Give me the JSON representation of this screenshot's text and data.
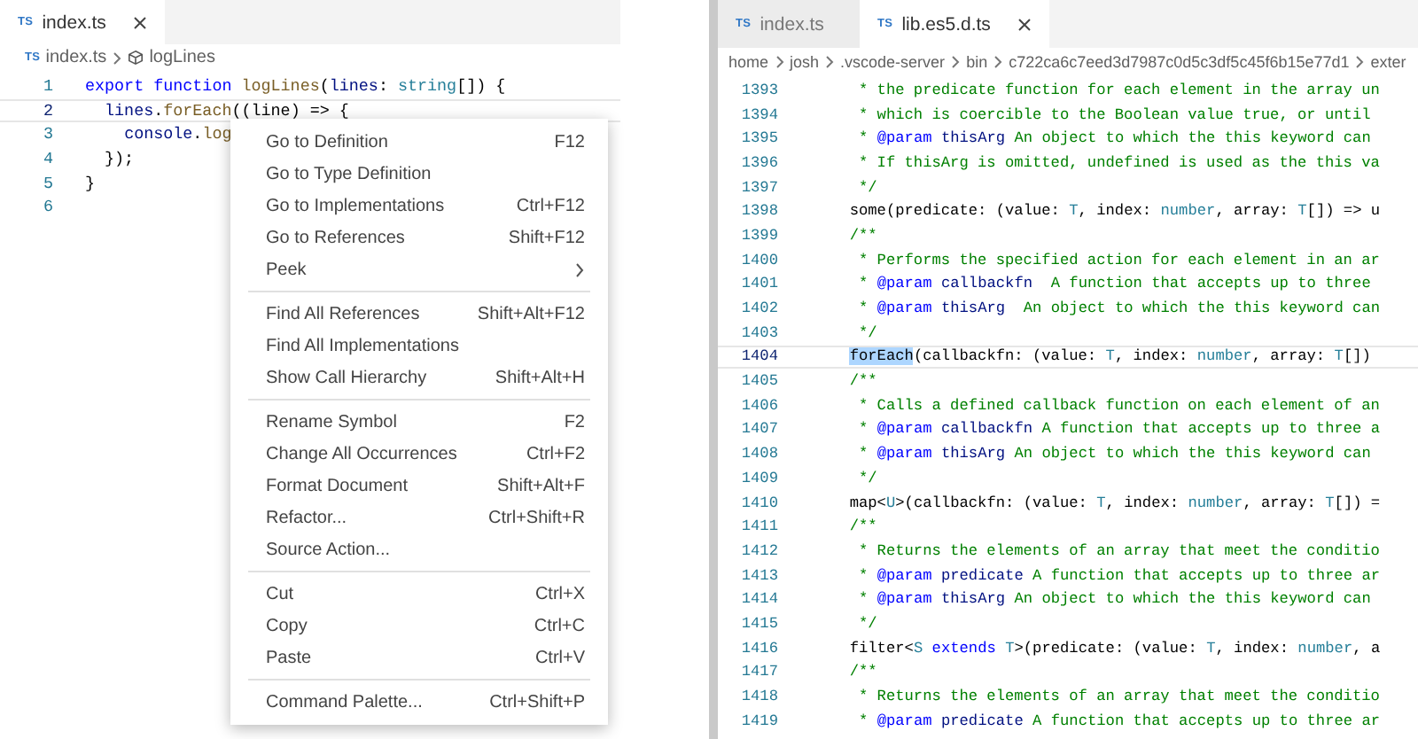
{
  "left_editor": {
    "tabs": [
      {
        "icon": "TS",
        "label": "index.ts",
        "selected": true
      }
    ],
    "breadcrumb": [
      {
        "kind": "file",
        "icon": "TS",
        "label": "index.ts"
      },
      {
        "kind": "symbol",
        "label": "logLines"
      }
    ],
    "lines": [
      {
        "number": "1",
        "current": false,
        "tokens": [
          {
            "kind": "kw",
            "t": "export"
          },
          {
            "kind": "kw",
            "t": " function"
          },
          {
            "kind": "fn",
            "t": " logLines"
          },
          {
            "kind": "plain",
            "t": "("
          },
          {
            "kind": "param",
            "t": "lines"
          },
          {
            "kind": "plain",
            "t": ":"
          },
          {
            "kind": "type",
            "t": " string"
          },
          {
            "kind": "plain",
            "t": "[]) {"
          }
        ]
      },
      {
        "number": "2",
        "current": true,
        "tokens": [
          {
            "kind": "param",
            "t": "  lines"
          },
          {
            "kind": "plain",
            "t": "."
          },
          {
            "kind": "fn",
            "t": "forEach"
          },
          {
            "kind": "plain",
            "t": "((line) => {"
          }
        ]
      },
      {
        "number": "3",
        "current": false,
        "tokens": [
          {
            "kind": "param",
            "t": "    console"
          },
          {
            "kind": "plain",
            "t": "."
          },
          {
            "kind": "fn",
            "t": "log"
          }
        ]
      },
      {
        "number": "4",
        "current": false,
        "tokens": [
          {
            "kind": "plain",
            "t": "  });"
          }
        ]
      },
      {
        "number": "5",
        "current": false,
        "tokens": [
          {
            "kind": "plain",
            "t": "}"
          }
        ]
      },
      {
        "number": "6",
        "current": false
      }
    ]
  },
  "context_menu": {
    "groups": [
      [
        {
          "label": "Go to Definition",
          "shortcut": "F12"
        },
        {
          "label": "Go to Type Definition"
        },
        {
          "label": "Go to Implementations",
          "shortcut": "Ctrl+F12"
        },
        {
          "label": "Go to References",
          "shortcut": "Shift+F12"
        },
        {
          "label": "Peek",
          "submenu": true
        }
      ],
      [
        {
          "label": "Find All References",
          "shortcut": "Shift+Alt+F12"
        },
        {
          "label": "Find All Implementations"
        },
        {
          "label": "Show Call Hierarchy",
          "shortcut": "Shift+Alt+H"
        }
      ],
      [
        {
          "label": "Rename Symbol",
          "shortcut": "F2"
        },
        {
          "label": "Change All Occurrences",
          "shortcut": "Ctrl+F2"
        },
        {
          "label": "Format Document",
          "shortcut": "Shift+Alt+F"
        },
        {
          "label": "Refactor...",
          "shortcut": "Ctrl+Shift+R"
        },
        {
          "label": "Source Action..."
        }
      ],
      [
        {
          "label": "Cut",
          "shortcut": "Ctrl+X"
        },
        {
          "label": "Copy",
          "shortcut": "Ctrl+C"
        },
        {
          "label": "Paste",
          "shortcut": "Ctrl+V"
        }
      ],
      [
        {
          "label": "Command Palette...",
          "shortcut": "Ctrl+Shift+P"
        }
      ]
    ]
  },
  "right_editor": {
    "tabs": [
      {
        "icon": "TS",
        "label": "index.ts",
        "selected": false
      },
      {
        "icon": "TS",
        "label": "lib.es5.d.ts",
        "selected": true
      }
    ],
    "breadcrumb": [
      {
        "label": "home"
      },
      {
        "label": "josh"
      },
      {
        "label": ".vscode-server"
      },
      {
        "label": "bin"
      },
      {
        "label": "c722ca6c7eed3d7987c0d5c3df5c45f6b15e77d1"
      },
      {
        "label": "exter"
      }
    ],
    "lines": [
      {
        "number": "1393",
        "current": false,
        "tokens": [
          {
            "kind": "comment",
            "t": "   * the predicate function for each element in the array un"
          }
        ]
      },
      {
        "number": "1394",
        "current": false,
        "tokens": [
          {
            "kind": "comment",
            "t": "   * which is coercible to the Boolean value true, or until"
          }
        ]
      },
      {
        "number": "1395",
        "current": false,
        "tokens": [
          {
            "kind": "comment",
            "t": "   *"
          },
          {
            "kind": "tag",
            "t": " @param"
          },
          {
            "kind": "param",
            "t": " thisArg"
          },
          {
            "kind": "comment",
            "t": " An object to which the this keyword can"
          }
        ]
      },
      {
        "number": "1396",
        "current": false,
        "tokens": [
          {
            "kind": "comment",
            "t": "   * If thisArg is omitted, undefined is used as the this va"
          }
        ]
      },
      {
        "number": "1397",
        "current": false,
        "tokens": [
          {
            "kind": "comment",
            "t": "   */"
          }
        ]
      },
      {
        "number": "1398",
        "current": false,
        "tokens": [
          {
            "kind": "plain",
            "t": "  some(predicate: (value:"
          },
          {
            "kind": "type",
            "t": " T"
          },
          {
            "kind": "plain",
            "t": ", index:"
          },
          {
            "kind": "type",
            "t": " number"
          },
          {
            "kind": "plain",
            "t": ", array:"
          },
          {
            "kind": "type",
            "t": " T"
          },
          {
            "kind": "plain",
            "t": "[]) => u"
          }
        ]
      },
      {
        "number": "1399",
        "current": false,
        "tokens": [
          {
            "kind": "comment",
            "t": "  /**"
          }
        ]
      },
      {
        "number": "1400",
        "current": false,
        "tokens": [
          {
            "kind": "comment",
            "t": "   * Performs the specified action for each element in an ar"
          }
        ]
      },
      {
        "number": "1401",
        "current": false,
        "tokens": [
          {
            "kind": "comment",
            "t": "   *"
          },
          {
            "kind": "tag",
            "t": " @param"
          },
          {
            "kind": "param",
            "t": " callbackfn"
          },
          {
            "kind": "comment",
            "t": "  A function that accepts up to three"
          }
        ]
      },
      {
        "number": "1402",
        "current": false,
        "tokens": [
          {
            "kind": "comment",
            "t": "   *"
          },
          {
            "kind": "tag",
            "t": " @param"
          },
          {
            "kind": "param",
            "t": " thisArg"
          },
          {
            "kind": "comment",
            "t": "  An object to which the this keyword can"
          }
        ]
      },
      {
        "number": "1403",
        "current": false,
        "tokens": [
          {
            "kind": "comment",
            "t": "   */"
          }
        ]
      },
      {
        "number": "1404",
        "current": true,
        "tokens": [
          {
            "kind": "match",
            "t": "  forEach"
          },
          {
            "kind": "plain",
            "t": "(callbackfn: (value:"
          },
          {
            "kind": "type",
            "t": " T"
          },
          {
            "kind": "plain",
            "t": ", index:"
          },
          {
            "kind": "type",
            "t": " number"
          },
          {
            "kind": "plain",
            "t": ", array:"
          },
          {
            "kind": "type",
            "t": " T"
          },
          {
            "kind": "plain",
            "t": "[])"
          }
        ]
      },
      {
        "number": "1405",
        "current": false,
        "tokens": [
          {
            "kind": "comment",
            "t": "  /**"
          }
        ]
      },
      {
        "number": "1406",
        "current": false,
        "tokens": [
          {
            "kind": "comment",
            "t": "   * Calls a defined callback function on each element of an"
          }
        ]
      },
      {
        "number": "1407",
        "current": false,
        "tokens": [
          {
            "kind": "comment",
            "t": "   *"
          },
          {
            "kind": "tag",
            "t": " @param"
          },
          {
            "kind": "param",
            "t": " callbackfn"
          },
          {
            "kind": "comment",
            "t": " A function that accepts up to three a"
          }
        ]
      },
      {
        "number": "1408",
        "current": false,
        "tokens": [
          {
            "kind": "comment",
            "t": "   *"
          },
          {
            "kind": "tag",
            "t": " @param"
          },
          {
            "kind": "param",
            "t": " thisArg"
          },
          {
            "kind": "comment",
            "t": " An object to which the this keyword can"
          }
        ]
      },
      {
        "number": "1409",
        "current": false,
        "tokens": [
          {
            "kind": "comment",
            "t": "   */"
          }
        ]
      },
      {
        "number": "1410",
        "current": false,
        "tokens": [
          {
            "kind": "plain",
            "t": "  map<"
          },
          {
            "kind": "type",
            "t": "U"
          },
          {
            "kind": "plain",
            "t": ">(callbackfn: (value:"
          },
          {
            "kind": "type",
            "t": " T"
          },
          {
            "kind": "plain",
            "t": ", index:"
          },
          {
            "kind": "type",
            "t": " number"
          },
          {
            "kind": "plain",
            "t": ", array:"
          },
          {
            "kind": "type",
            "t": " T"
          },
          {
            "kind": "plain",
            "t": "[]) ="
          }
        ]
      },
      {
        "number": "1411",
        "current": false,
        "tokens": [
          {
            "kind": "comment",
            "t": "  /**"
          }
        ]
      },
      {
        "number": "1412",
        "current": false,
        "tokens": [
          {
            "kind": "comment",
            "t": "   * Returns the elements of an array that meet the conditio"
          }
        ]
      },
      {
        "number": "1413",
        "current": false,
        "tokens": [
          {
            "kind": "comment",
            "t": "   *"
          },
          {
            "kind": "tag",
            "t": " @param"
          },
          {
            "kind": "param",
            "t": " predicate"
          },
          {
            "kind": "comment",
            "t": " A function that accepts up to three ar"
          }
        ]
      },
      {
        "number": "1414",
        "current": false,
        "tokens": [
          {
            "kind": "comment",
            "t": "   *"
          },
          {
            "kind": "tag",
            "t": " @param"
          },
          {
            "kind": "param",
            "t": " thisArg"
          },
          {
            "kind": "comment",
            "t": " An object to which the this keyword can"
          }
        ]
      },
      {
        "number": "1415",
        "current": false,
        "tokens": [
          {
            "kind": "comment",
            "t": "   */"
          }
        ]
      },
      {
        "number": "1416",
        "current": false,
        "tokens": [
          {
            "kind": "plain",
            "t": "  filter<"
          },
          {
            "kind": "type",
            "t": "S"
          },
          {
            "kind": "kw",
            "t": " extends"
          },
          {
            "kind": "type",
            "t": " T"
          },
          {
            "kind": "plain",
            "t": ">(predicate: (value:"
          },
          {
            "kind": "type",
            "t": " T"
          },
          {
            "kind": "plain",
            "t": ", index:"
          },
          {
            "kind": "type",
            "t": " number"
          },
          {
            "kind": "plain",
            "t": ", a"
          }
        ]
      },
      {
        "number": "1417",
        "current": false,
        "tokens": [
          {
            "kind": "comment",
            "t": "  /**"
          }
        ]
      },
      {
        "number": "1418",
        "current": false,
        "tokens": [
          {
            "kind": "comment",
            "t": "   * Returns the elements of an array that meet the conditio"
          }
        ]
      },
      {
        "number": "1419",
        "current": false,
        "tokens": [
          {
            "kind": "comment",
            "t": "   *"
          },
          {
            "kind": "tag",
            "t": " @param"
          },
          {
            "kind": "param",
            "t": " predicate"
          },
          {
            "kind": "comment",
            "t": " A function that accepts up to three ar"
          }
        ]
      }
    ]
  }
}
